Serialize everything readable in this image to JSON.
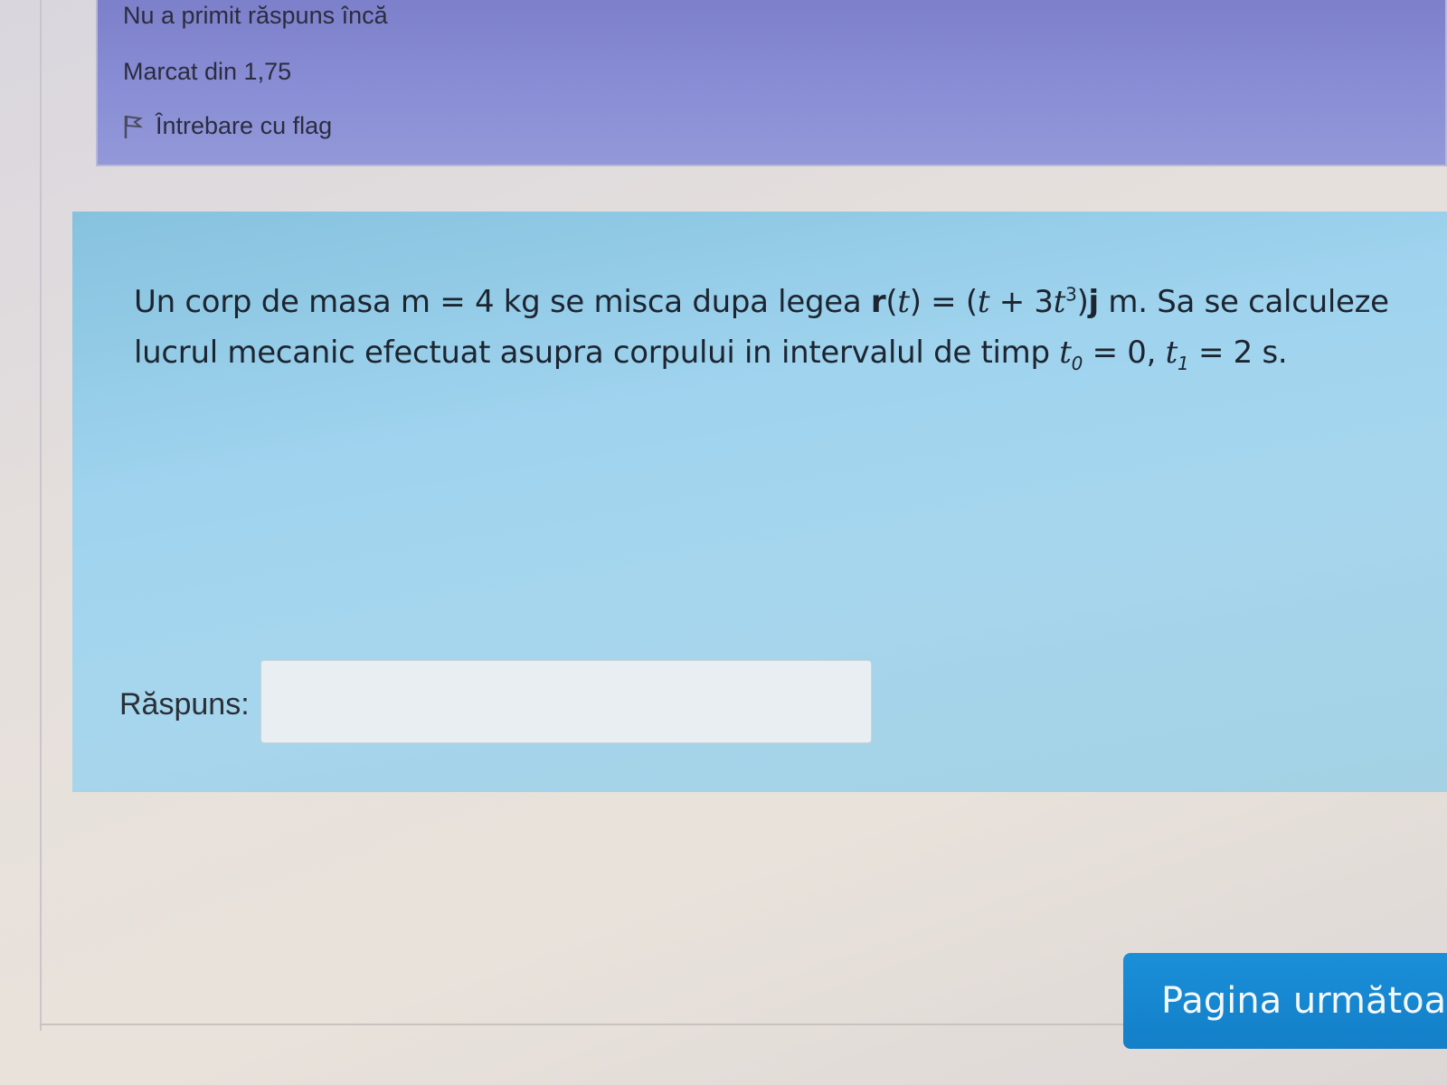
{
  "info": {
    "state": "Nu a primit răspuns încă",
    "grade": "Marcat din 1,75",
    "flag_label": "Întrebare cu flag",
    "flag_icon": "flag-icon"
  },
  "question": {
    "line1_start": "Un corp de masa m = 4 kg se misca dupa legea ",
    "vector_r": "r",
    "paren_t_open": "(",
    "t1": "t",
    "eq_part": ") = (",
    "t2": "t",
    "plus_3": " + 3",
    "t3": "t",
    "exp3": "3",
    "close_paren": ")",
    "vector_j": "j",
    "line1_end": "  m. Sa se calculeze",
    "line2_start": "lucrul mecanic efectuat asupra corpului in intervalul de timp ",
    "t0": "t",
    "sub0": "0",
    "eq0": " = 0,  ",
    "t1b": "t",
    "sub1": "1",
    "eq1": " = 2 s."
  },
  "answer": {
    "label": "Răspuns:",
    "value": "",
    "placeholder": ""
  },
  "navigation": {
    "next_label": "Pagina următoare"
  },
  "colors": {
    "info_bg": "#878bd3",
    "question_bg": "#9fd3ee",
    "button_bg": "#1a8fd8"
  }
}
